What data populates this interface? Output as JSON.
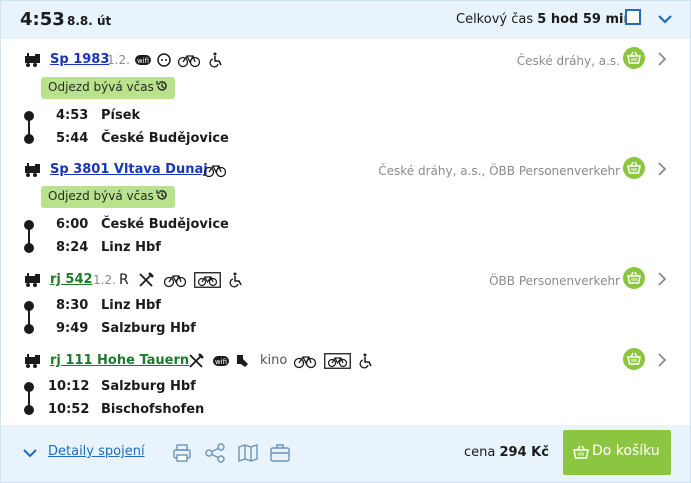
{
  "header": {
    "time": "4:53",
    "date": "8.8. út",
    "total_label": "Celkový čas",
    "total_value": "5 hod 59 min"
  },
  "legs": [
    {
      "train": "Sp 1983",
      "class": "1.2.",
      "services": [
        "wifi-icon",
        "power-socket-icon",
        "bicycle-icon",
        "wheelchair-icon"
      ],
      "carrier": "České dráhy, a.s.",
      "badge": "Odjezd bývá včas",
      "stops": [
        {
          "time": "4:53",
          "name": "Písek"
        },
        {
          "time": "5:44",
          "name": "České Budějovice"
        }
      ]
    },
    {
      "train": "Sp 3801 Vltava Dunaj",
      "services": [
        "bicycle-icon"
      ],
      "carrier": "České dráhy, a.s., ÖBB Personenverkehr",
      "badge": "Odjezd bývá včas",
      "stops": [
        {
          "time": "6:00",
          "name": "České Budějovice"
        },
        {
          "time": "8:24",
          "name": "Linz Hbf"
        }
      ]
    },
    {
      "train": "rj 542",
      "class": "1.2.",
      "services": [
        "reservation-R",
        "restaurant-icon",
        "bicycle-icon",
        "bicycle-reservation-icon",
        "wheelchair-icon"
      ],
      "service_text": "R",
      "carrier": "ÖBB Personenverkehr",
      "stops": [
        {
          "time": "8:30",
          "name": "Linz Hbf"
        },
        {
          "time": "9:49",
          "name": "Salzburg Hbf"
        }
      ]
    },
    {
      "train": "rj 111 Hohe Tauern",
      "services": [
        "restaurant-icon",
        "wifi-icon",
        "snack-icon",
        "cinema",
        "bicycle-icon",
        "bicycle-reservation-icon",
        "wheelchair-icon"
      ],
      "service_text": "kino",
      "carrier": "",
      "stops": [
        {
          "time": "10:12",
          "name": "Salzburg Hbf"
        },
        {
          "time": "10:52",
          "name": "Bischofshofen"
        }
      ]
    }
  ],
  "footer": {
    "details_label": "Detaily spojení",
    "price_label": "cena",
    "price_value": "294 Kč",
    "cart_button": "Do košíku"
  },
  "colors": {
    "header_bg": "#e8f3fb",
    "link_blue": "#1a36b6",
    "link_green": "#1e7b2c",
    "badge_bg": "#b8e28b",
    "button_green": "#8cc640",
    "accent_blue": "#1c6cbf"
  }
}
